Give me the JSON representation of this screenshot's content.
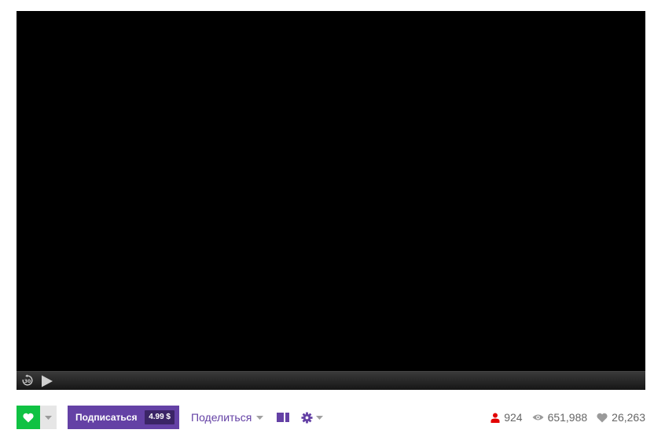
{
  "colors": {
    "follow_green": "#10c243",
    "twitch_purple": "#6441a5",
    "price_bg": "#3b2566",
    "viewers_red": "#e30000",
    "stat_gray": "#666666"
  },
  "player": {
    "icons": {
      "rewind": "rewind-30-icon",
      "play": "play-icon"
    },
    "rewind_label": "30"
  },
  "actions": {
    "follow_icon": "heart-icon",
    "subscribe_label": "Подписаться",
    "subscribe_price": "4.99 $",
    "share_label": "Поделиться",
    "theater_icon": "theater-mode-icon",
    "settings_icon": "gear-icon"
  },
  "stats": {
    "viewers": "924",
    "views": "651,988",
    "followers": "26,263",
    "icons": {
      "viewers": "person-icon",
      "views": "eye-icon",
      "followers": "heart-icon"
    }
  }
}
